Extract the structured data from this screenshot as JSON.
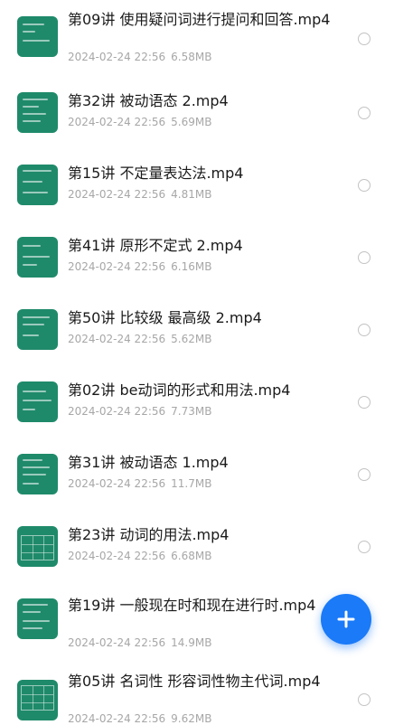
{
  "files": [
    {
      "title": "第09讲 使用疑问词进行提问和回答.mp4",
      "date": "2024-02-24 22:56",
      "size": "6.58MB"
    },
    {
      "title": "第32讲 被动语态  2.mp4",
      "date": "2024-02-24 22:56",
      "size": "5.69MB"
    },
    {
      "title": "第15讲 不定量表达法.mp4",
      "date": "2024-02-24 22:56",
      "size": "4.81MB"
    },
    {
      "title": "第41讲 原形不定式 2.mp4",
      "date": "2024-02-24 22:56",
      "size": "6.16MB"
    },
    {
      "title": "第50讲 比较级 最高级 2.mp4",
      "date": "2024-02-24 22:56",
      "size": "5.62MB"
    },
    {
      "title": "第02讲 be动词的形式和用法.mp4",
      "date": "2024-02-24 22:56",
      "size": "7.73MB"
    },
    {
      "title": "第31讲 被动语态  1.mp4",
      "date": "2024-02-24 22:56",
      "size": "11.7MB"
    },
    {
      "title": "第23讲 动词的用法.mp4",
      "date": "2024-02-24 22:56",
      "size": "6.68MB"
    },
    {
      "title": "第19讲 一般现在时和现在进行时.mp4",
      "date": "2024-02-24 22:56",
      "size": "14.9MB"
    },
    {
      "title": "第05讲 名词性 形容词性物主代词.mp4",
      "date": "2024-02-24 22:56",
      "size": "9.62MB"
    }
  ],
  "fab": {
    "icon": "plus-icon"
  },
  "colors": {
    "accent": "#1a7af8",
    "thumbnail": "#1f8a6a"
  }
}
